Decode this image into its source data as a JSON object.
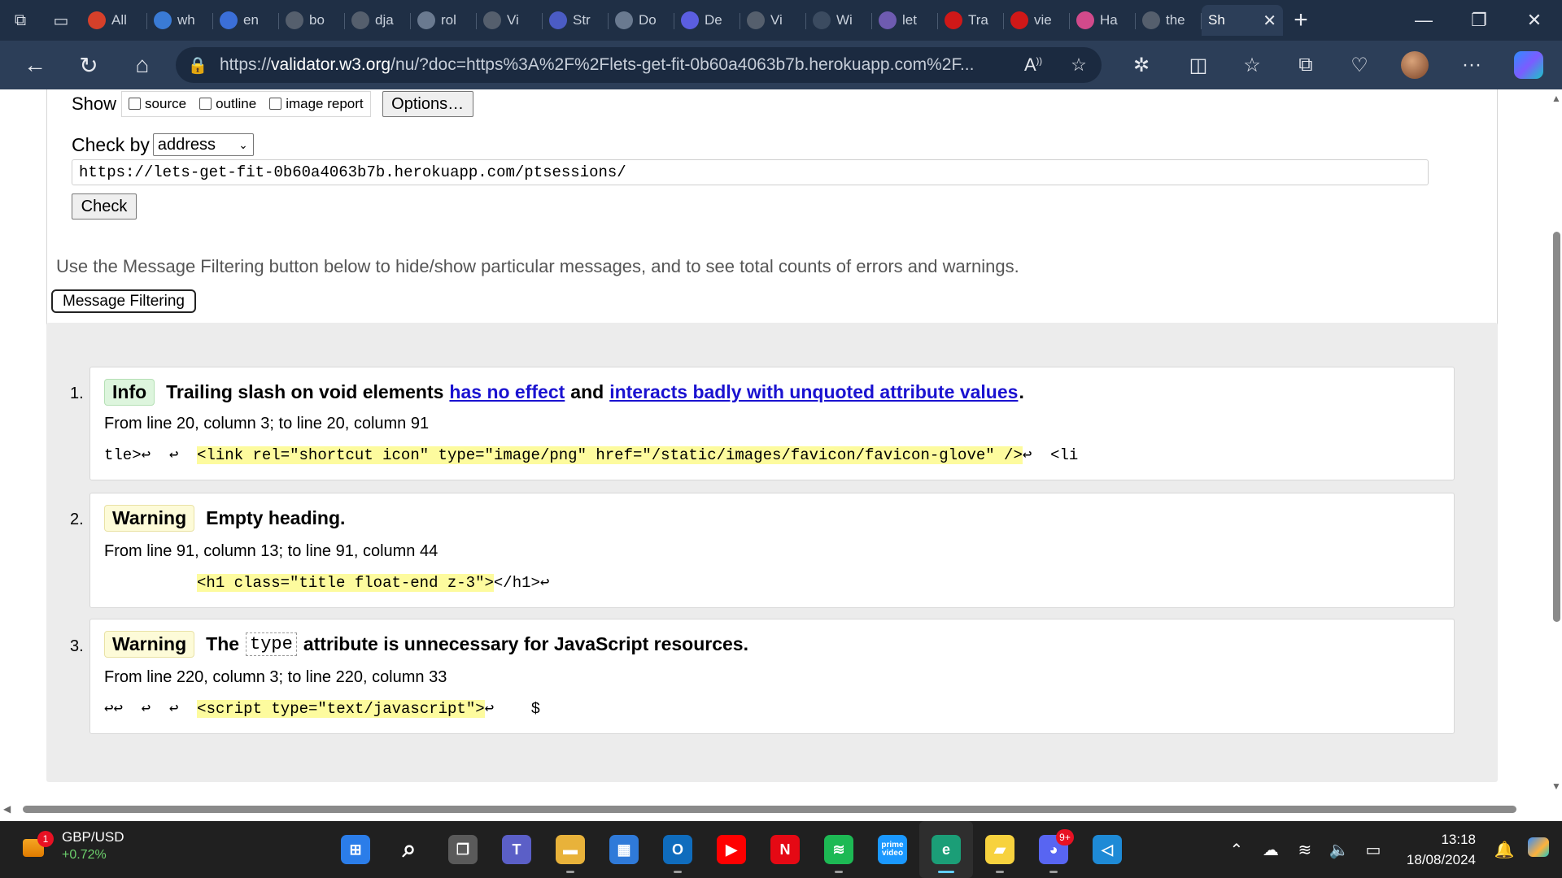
{
  "browser": {
    "tabs": [
      {
        "label": "All",
        "icon": "opera-icon",
        "color": "#d6402a"
      },
      {
        "label": "wh",
        "icon": "bing-icon",
        "color": "#3a7bd5"
      },
      {
        "label": "en",
        "icon": "search-icon",
        "color": "#3b6fd8"
      },
      {
        "label": "bo",
        "icon": "github-icon",
        "color": "#555f6d"
      },
      {
        "label": "dja",
        "icon": "github-icon",
        "color": "#555f6d"
      },
      {
        "label": "rol",
        "icon": "google-icon",
        "color": "#6a7a90"
      },
      {
        "label": "Vi",
        "icon": "github-icon",
        "color": "#555f6d"
      },
      {
        "label": "Str",
        "icon": "s-icon",
        "color": "#4b5cc4"
      },
      {
        "label": "Do",
        "icon": "loop-icon",
        "color": "#6a7a90"
      },
      {
        "label": "De",
        "icon": "s-icon",
        "color": "#5b5ee0"
      },
      {
        "label": "Vi",
        "icon": "github-icon",
        "color": "#555f6d"
      },
      {
        "label": "Wi",
        "icon": "django-icon",
        "color": "#3b4b60"
      },
      {
        "label": "let",
        "icon": "heroku-icon",
        "color": "#6e5bb0"
      },
      {
        "label": "Tra",
        "icon": "codeinstitute-icon",
        "color": "#d01818"
      },
      {
        "label": "vie",
        "icon": "codeinstitute-icon",
        "color": "#d01818"
      },
      {
        "label": "Ha",
        "icon": "slack-icon",
        "color": "#d14a8b"
      },
      {
        "label": "the",
        "icon": "github-icon",
        "color": "#555f6d"
      }
    ],
    "active_tab": {
      "label": "Sh",
      "icon": "w3c-icon"
    },
    "url_prefix": "https://",
    "url_domain": "validator.w3.org",
    "url_rest": "/nu/?doc=https%3A%2F%2Flets-get-fit-0b60a4063b7b.herokuapp.com%2F..."
  },
  "form": {
    "show_label": "Show",
    "show_options": [
      "source",
      "outline",
      "image report"
    ],
    "options_button": "Options…",
    "checkby_label": "Check by",
    "checkby_value": "address",
    "url_value": "https://lets-get-fit-0b60a4063b7b.herokuapp.com/ptsessions/",
    "check_button": "Check"
  },
  "filter_note": "Use the Message Filtering button below to hide/show particular messages, and to see total counts of errors and warnings.",
  "filter_button": "Message Filtering",
  "messages": [
    {
      "num": "1.",
      "type": "Info",
      "text_before": "Trailing slash on void elements",
      "link1": "has no effect",
      "mid": "and",
      "link2": "interacts badly with unquoted attribute values",
      "end": ".",
      "location": "From line 20, column 3; to line 20, column 91",
      "ext_before": "tle>↩  ↩  ",
      "ext_highlight": "<link rel=\"shortcut icon\" type=\"image/png\" href=\"/static/images/favicon/favicon-glove\" />",
      "ext_after": "↩  <li"
    },
    {
      "num": "2.",
      "type": "Warning",
      "text": "Empty heading.",
      "location": "From line 91, column 13; to line 91, column 44",
      "ext_before": "          ",
      "ext_highlight": "<h1 class=\"title float-end z-3\">",
      "ext_after": "</h1>↩"
    },
    {
      "num": "3.",
      "type": "Warning",
      "text_before": "The",
      "code": "type",
      "text_after": "attribute is unnecessary for JavaScript resources.",
      "location": "From line 220, column 3; to line 220, column 33",
      "ext_before": "↩↩  ↩  ↩  ",
      "ext_highlight": "<script type=\"text/javascript\">",
      "ext_after": "↩    $"
    }
  ],
  "taskbar": {
    "widget_title": "GBP/USD",
    "widget_value": "+0.72%",
    "widget_badge": "1",
    "apps": [
      {
        "name": "start-button",
        "label": "⊞",
        "color": "#2b7de9"
      },
      {
        "name": "search-button",
        "label": "⌕",
        "color": "transparent"
      },
      {
        "name": "task-view-button",
        "label": "❐",
        "color": "#5a5a5a"
      },
      {
        "name": "teams-app",
        "label": "T",
        "color": "#5b5fc7"
      },
      {
        "name": "file-explorer-app",
        "label": "▬",
        "color": "#e8b23a"
      },
      {
        "name": "ms-store-app",
        "label": "▦",
        "color": "#2f7ad9"
      },
      {
        "name": "outlook-app",
        "label": "O",
        "color": "#0f6cbd"
      },
      {
        "name": "youtube-app",
        "label": "▶",
        "color": "#ff0000"
      },
      {
        "name": "netflix-app",
        "label": "N",
        "color": "#e50914"
      },
      {
        "name": "spotify-app",
        "label": "≋",
        "color": "#1db954"
      },
      {
        "name": "prime-video-app",
        "label": "prime video",
        "color": "#1a98ff"
      },
      {
        "name": "edge-app",
        "label": "e",
        "color": "#1b9e77"
      },
      {
        "name": "sticky-notes-app",
        "label": "▰",
        "color": "#f7d23e"
      },
      {
        "name": "discord-app",
        "label": "◕",
        "color": "#5865f2"
      },
      {
        "name": "vscode-app",
        "label": "◁",
        "color": "#1e8ad6"
      }
    ],
    "discord_badge": "9+",
    "time": "13:18",
    "date": "18/08/2024"
  }
}
